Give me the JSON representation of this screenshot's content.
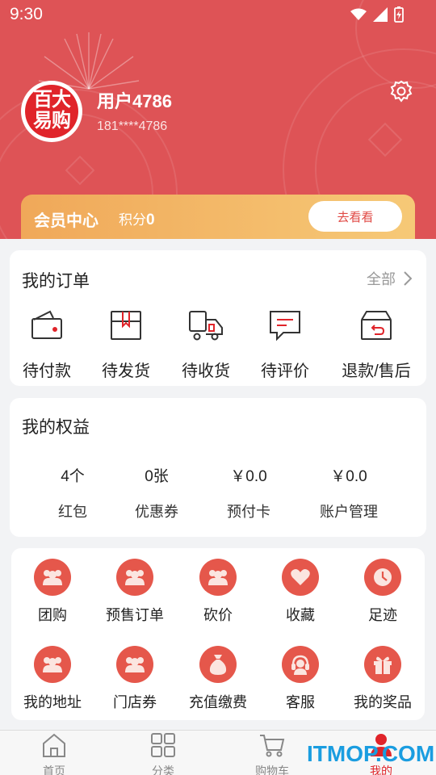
{
  "status_bar": {
    "time": "9:30"
  },
  "profile": {
    "avatar_text_line1": "百大",
    "avatar_text_line2": "易购",
    "username": "用户4786",
    "phone": "181****4786"
  },
  "member": {
    "title": "会员中心",
    "points_label": "积分",
    "points_value": "0",
    "button_label": "去看看"
  },
  "orders": {
    "title": "我的订单",
    "see_all": "全部",
    "items": [
      {
        "label": "待付款",
        "icon": "wallet-icon"
      },
      {
        "label": "待发货",
        "icon": "package-icon"
      },
      {
        "label": "待收货",
        "icon": "truck-icon"
      },
      {
        "label": "待评价",
        "icon": "comment-icon"
      },
      {
        "label": "退款/售后",
        "icon": "return-box-icon"
      }
    ]
  },
  "rights": {
    "title": "我的权益",
    "items": [
      {
        "value": "4个",
        "label": "红包"
      },
      {
        "value": "0张",
        "label": "优惠券"
      },
      {
        "value": "￥0.0",
        "label": "预付卡"
      },
      {
        "value": "￥0.0",
        "label": "账户管理"
      }
    ]
  },
  "services": [
    {
      "label": "团购",
      "icon": "group-icon"
    },
    {
      "label": "预售订单",
      "icon": "group-icon"
    },
    {
      "label": "砍价",
      "icon": "group-icon"
    },
    {
      "label": "收藏",
      "icon": "heart-icon"
    },
    {
      "label": "足迹",
      "icon": "clock-icon"
    },
    {
      "label": "我的地址",
      "icon": "group-icon"
    },
    {
      "label": "门店券",
      "icon": "group-icon"
    },
    {
      "label": "充值缴费",
      "icon": "money-bag-icon"
    },
    {
      "label": "客服",
      "icon": "headset-icon"
    },
    {
      "label": "我的奖品",
      "icon": "gift-icon"
    }
  ],
  "tabbar": [
    {
      "label": "首页",
      "icon": "home-icon"
    },
    {
      "label": "分类",
      "icon": "grid-icon"
    },
    {
      "label": "购物车",
      "icon": "cart-icon"
    },
    {
      "label": "我的",
      "icon": "person-icon",
      "active": true
    }
  ],
  "watermark": "ITMOP.COM",
  "colors": {
    "brand_red": "#de5356",
    "accent_red": "#e0242a",
    "gold": "#f0a859",
    "icon_circle": "#e5574b"
  }
}
